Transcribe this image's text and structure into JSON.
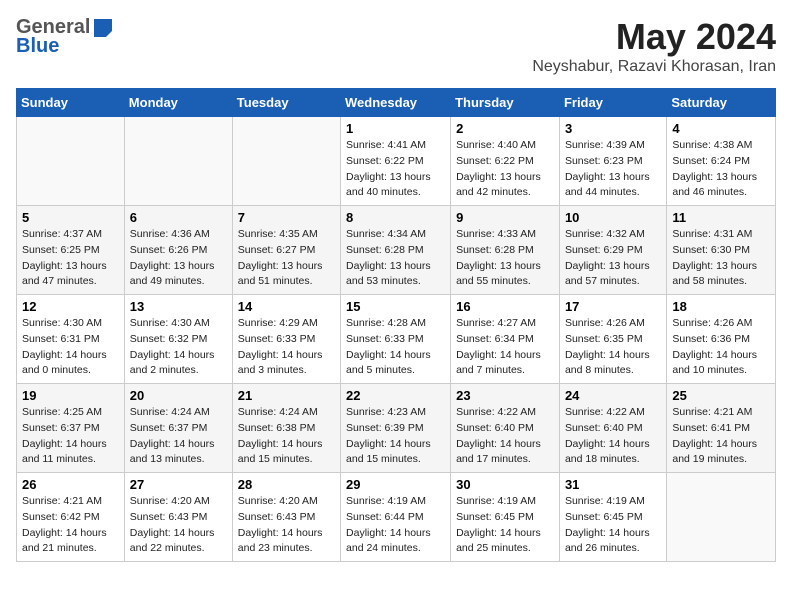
{
  "header": {
    "logo_general": "General",
    "logo_blue": "Blue",
    "month_title": "May 2024",
    "subtitle": "Neyshabur, Razavi Khorasan, Iran"
  },
  "weekdays": [
    "Sunday",
    "Monday",
    "Tuesday",
    "Wednesday",
    "Thursday",
    "Friday",
    "Saturday"
  ],
  "weeks": [
    [
      {
        "day": "",
        "info": ""
      },
      {
        "day": "",
        "info": ""
      },
      {
        "day": "",
        "info": ""
      },
      {
        "day": "1",
        "info": "Sunrise: 4:41 AM\nSunset: 6:22 PM\nDaylight: 13 hours\nand 40 minutes."
      },
      {
        "day": "2",
        "info": "Sunrise: 4:40 AM\nSunset: 6:22 PM\nDaylight: 13 hours\nand 42 minutes."
      },
      {
        "day": "3",
        "info": "Sunrise: 4:39 AM\nSunset: 6:23 PM\nDaylight: 13 hours\nand 44 minutes."
      },
      {
        "day": "4",
        "info": "Sunrise: 4:38 AM\nSunset: 6:24 PM\nDaylight: 13 hours\nand 46 minutes."
      }
    ],
    [
      {
        "day": "5",
        "info": "Sunrise: 4:37 AM\nSunset: 6:25 PM\nDaylight: 13 hours\nand 47 minutes."
      },
      {
        "day": "6",
        "info": "Sunrise: 4:36 AM\nSunset: 6:26 PM\nDaylight: 13 hours\nand 49 minutes."
      },
      {
        "day": "7",
        "info": "Sunrise: 4:35 AM\nSunset: 6:27 PM\nDaylight: 13 hours\nand 51 minutes."
      },
      {
        "day": "8",
        "info": "Sunrise: 4:34 AM\nSunset: 6:28 PM\nDaylight: 13 hours\nand 53 minutes."
      },
      {
        "day": "9",
        "info": "Sunrise: 4:33 AM\nSunset: 6:28 PM\nDaylight: 13 hours\nand 55 minutes."
      },
      {
        "day": "10",
        "info": "Sunrise: 4:32 AM\nSunset: 6:29 PM\nDaylight: 13 hours\nand 57 minutes."
      },
      {
        "day": "11",
        "info": "Sunrise: 4:31 AM\nSunset: 6:30 PM\nDaylight: 13 hours\nand 58 minutes."
      }
    ],
    [
      {
        "day": "12",
        "info": "Sunrise: 4:30 AM\nSunset: 6:31 PM\nDaylight: 14 hours\nand 0 minutes."
      },
      {
        "day": "13",
        "info": "Sunrise: 4:30 AM\nSunset: 6:32 PM\nDaylight: 14 hours\nand 2 minutes."
      },
      {
        "day": "14",
        "info": "Sunrise: 4:29 AM\nSunset: 6:33 PM\nDaylight: 14 hours\nand 3 minutes."
      },
      {
        "day": "15",
        "info": "Sunrise: 4:28 AM\nSunset: 6:33 PM\nDaylight: 14 hours\nand 5 minutes."
      },
      {
        "day": "16",
        "info": "Sunrise: 4:27 AM\nSunset: 6:34 PM\nDaylight: 14 hours\nand 7 minutes."
      },
      {
        "day": "17",
        "info": "Sunrise: 4:26 AM\nSunset: 6:35 PM\nDaylight: 14 hours\nand 8 minutes."
      },
      {
        "day": "18",
        "info": "Sunrise: 4:26 AM\nSunset: 6:36 PM\nDaylight: 14 hours\nand 10 minutes."
      }
    ],
    [
      {
        "day": "19",
        "info": "Sunrise: 4:25 AM\nSunset: 6:37 PM\nDaylight: 14 hours\nand 11 minutes."
      },
      {
        "day": "20",
        "info": "Sunrise: 4:24 AM\nSunset: 6:37 PM\nDaylight: 14 hours\nand 13 minutes."
      },
      {
        "day": "21",
        "info": "Sunrise: 4:24 AM\nSunset: 6:38 PM\nDaylight: 14 hours\nand 15 minutes."
      },
      {
        "day": "22",
        "info": "Sunrise: 4:23 AM\nSunset: 6:39 PM\nDaylight: 14 hours\nand 15 minutes."
      },
      {
        "day": "23",
        "info": "Sunrise: 4:22 AM\nSunset: 6:40 PM\nDaylight: 14 hours\nand 17 minutes."
      },
      {
        "day": "24",
        "info": "Sunrise: 4:22 AM\nSunset: 6:40 PM\nDaylight: 14 hours\nand 18 minutes."
      },
      {
        "day": "25",
        "info": "Sunrise: 4:21 AM\nSunset: 6:41 PM\nDaylight: 14 hours\nand 19 minutes."
      }
    ],
    [
      {
        "day": "26",
        "info": "Sunrise: 4:21 AM\nSunset: 6:42 PM\nDaylight: 14 hours\nand 21 minutes."
      },
      {
        "day": "27",
        "info": "Sunrise: 4:20 AM\nSunset: 6:43 PM\nDaylight: 14 hours\nand 22 minutes."
      },
      {
        "day": "28",
        "info": "Sunrise: 4:20 AM\nSunset: 6:43 PM\nDaylight: 14 hours\nand 23 minutes."
      },
      {
        "day": "29",
        "info": "Sunrise: 4:19 AM\nSunset: 6:44 PM\nDaylight: 14 hours\nand 24 minutes."
      },
      {
        "day": "30",
        "info": "Sunrise: 4:19 AM\nSunset: 6:45 PM\nDaylight: 14 hours\nand 25 minutes."
      },
      {
        "day": "31",
        "info": "Sunrise: 4:19 AM\nSunset: 6:45 PM\nDaylight: 14 hours\nand 26 minutes."
      },
      {
        "day": "",
        "info": ""
      }
    ]
  ]
}
